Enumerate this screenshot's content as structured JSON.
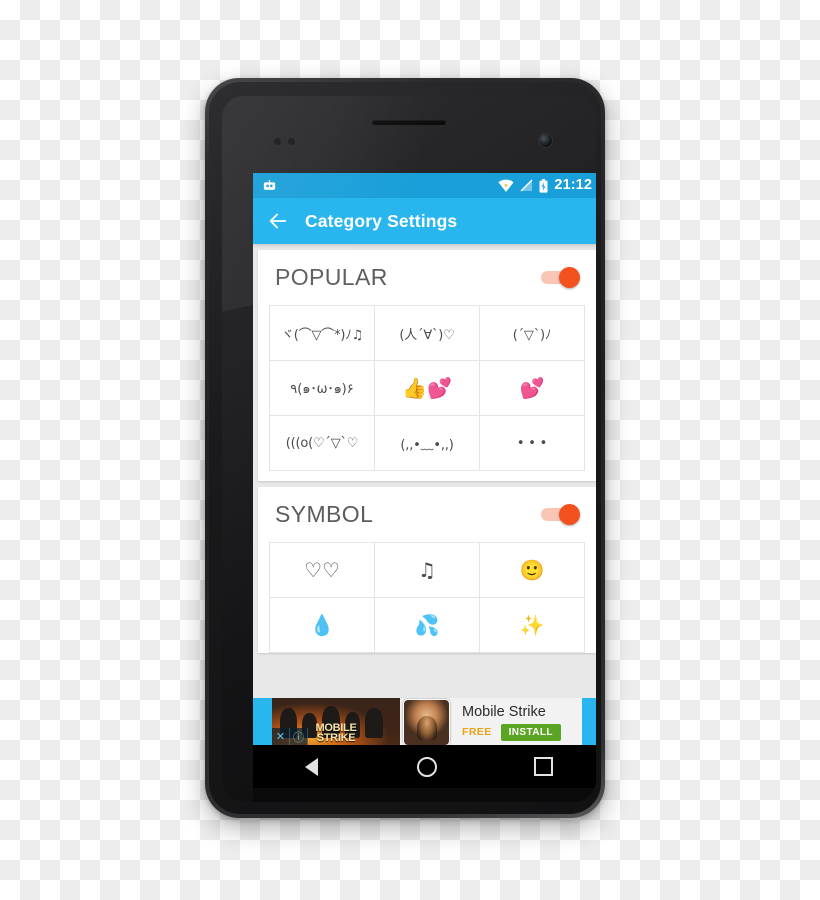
{
  "device": {
    "name": "android-smartphone",
    "bezel_color": "#232326"
  },
  "status_bar": {
    "notification_icon": "cyanogenmod-robot-icon",
    "wifi_icon": "wifi-icon",
    "signal_icon": "signal-off-icon",
    "battery_icon": "battery-charging-icon",
    "time": "21:12",
    "background_color": "#199fd9"
  },
  "app_bar": {
    "back_icon": "back-arrow-icon",
    "title": "Category Settings",
    "background_color": "#29b6ef"
  },
  "sections": [
    {
      "id": "popular",
      "title": "POPULAR",
      "toggle_on": true,
      "toggle_color": "#f4511e",
      "items": [
        "ヾ(⌒▽⌒*)ﾉ♫",
        "(人´∀`)♡",
        "(´▽`)ﾉ",
        "٩(๑･ω･๑)۶",
        "👍💕",
        "💕",
        "(((o(♡´▽`♡",
        "(,,•﹏•,,)",
        "• • •"
      ]
    },
    {
      "id": "symbol",
      "title": "SYMBOL",
      "toggle_on": true,
      "toggle_color": "#f4511e",
      "items": [
        "♡♡",
        "♫",
        "🙂",
        "💧",
        "💦",
        "✨"
      ]
    }
  ],
  "ad": {
    "close_label": "✕",
    "info_label": "ⓘ",
    "artwork_title": "MOBILE\nSTRIKE",
    "title": "Mobile Strike",
    "price_label": "FREE",
    "install_label": "INSTALL",
    "install_color": "#5ba524",
    "background_color": "#29b6ef"
  },
  "nav_bar": {
    "back": "back-nav-icon",
    "home": "home-nav-icon",
    "recents": "recents-nav-icon"
  }
}
